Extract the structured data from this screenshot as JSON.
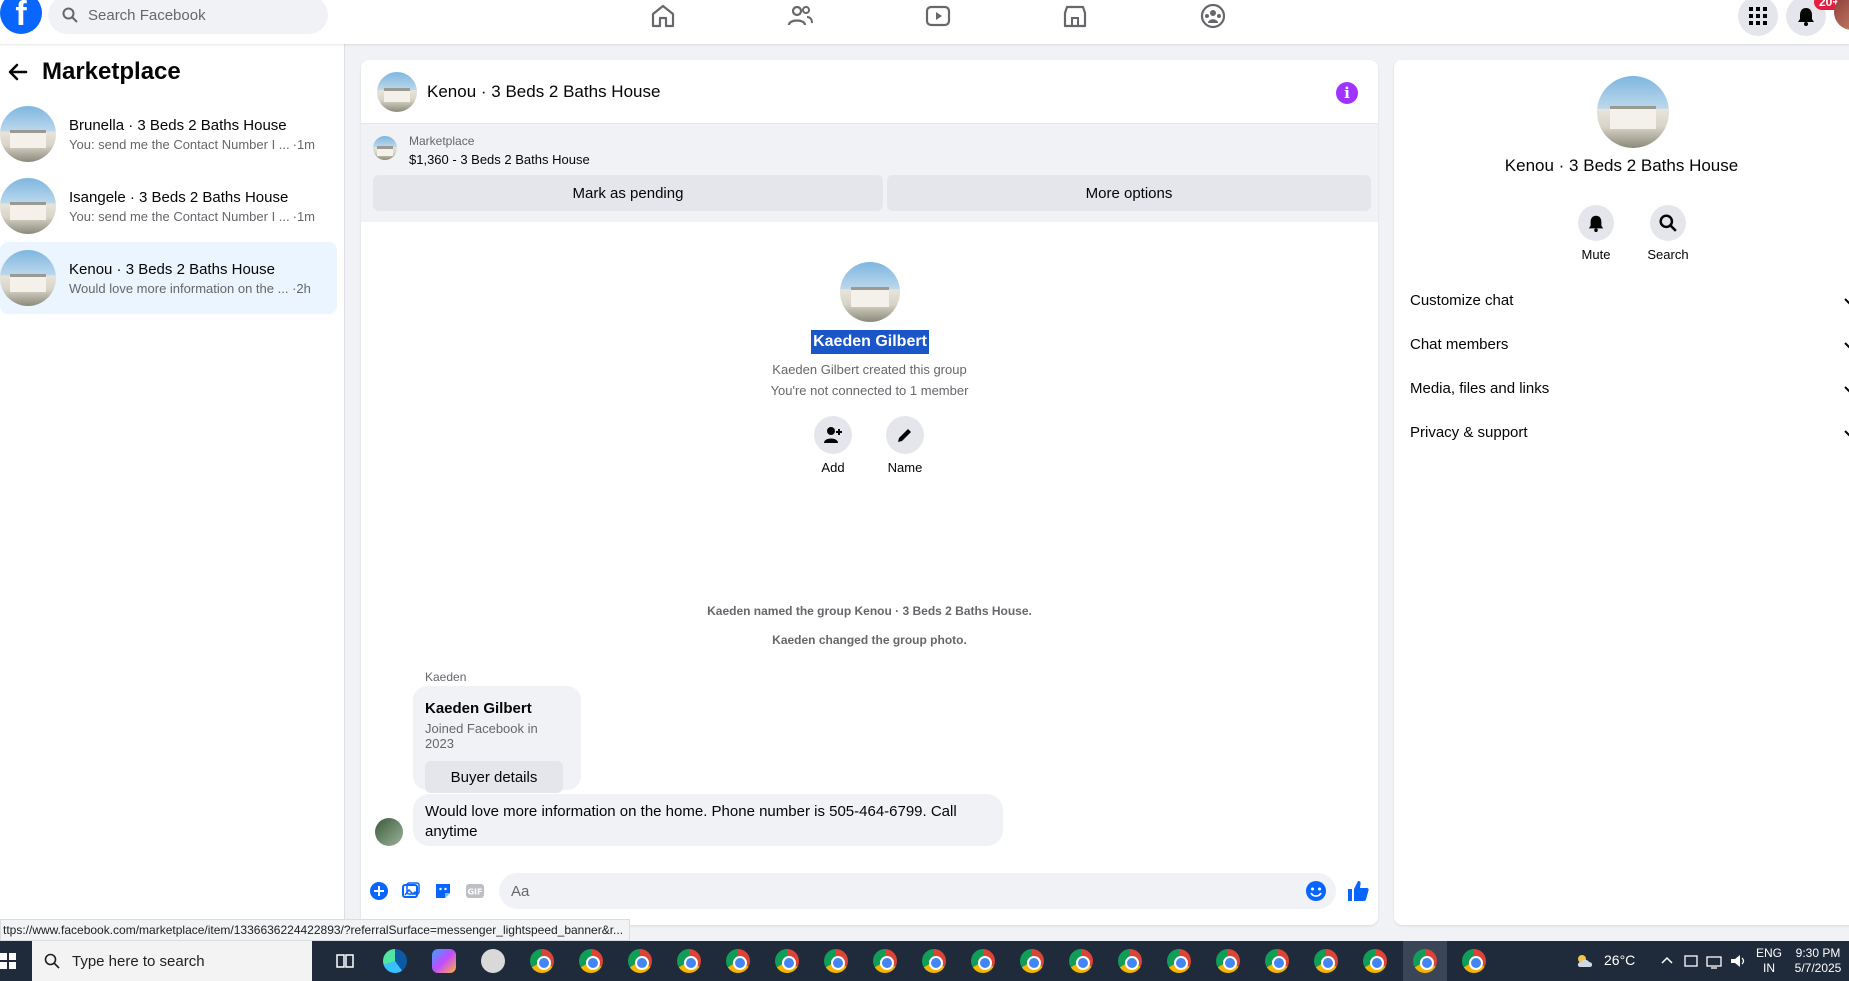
{
  "topbar": {
    "logo": "f",
    "search_placeholder": "Search Facebook",
    "notif_badge": "20+",
    "nav_icons": [
      "home-icon",
      "friends-icon",
      "watch-icon",
      "marketplace-icon",
      "groups-icon"
    ]
  },
  "sidebar": {
    "title": "Marketplace",
    "conversations": [
      {
        "title": "Brunella · 3 Beds 2 Baths House",
        "preview": "You: send me the Contact Number I ...",
        "time": "·1m"
      },
      {
        "title": "Isangele · 3 Beds 2 Baths House",
        "preview": "You: send me the Contact Number I ...",
        "time": "·1m"
      },
      {
        "title": "Kenou · 3 Beds 2 Baths House",
        "preview": "Would love more information on the ...",
        "time": "·2h"
      }
    ]
  },
  "chat": {
    "title": "Kenou · 3 Beds 2 Baths House",
    "marketplace_label": "Marketplace",
    "listing": "$1,360 - 3 Beds 2 Baths House",
    "mark_pending": "Mark as pending",
    "more_options": "More options",
    "member_name": "Kaeden Gilbert",
    "created_text": "Kaeden Gilbert created this group",
    "connected_text": "You're not connected to 1 member",
    "add_label": "Add",
    "name_label": "Name",
    "sys_named": "Kaeden named the group Kenou · 3 Beds 2 Baths House.",
    "sys_photo": "Kaeden changed the group photo.",
    "sender": "Kaeden",
    "card_name": "Kaeden Gilbert",
    "card_joined": "Joined Facebook in 2023",
    "card_button": "Buyer details",
    "message": "Would love more information on the home. Phone number is 505-464-6799. Call anytime",
    "composer_placeholder": "Aa"
  },
  "rpanel": {
    "name": "Kenou · 3 Beds 2 Baths House",
    "mute": "Mute",
    "search": "Search",
    "items": [
      "Customize chat",
      "Chat members",
      "Media, files and links",
      "Privacy & support"
    ]
  },
  "status_url": "ttps://www.facebook.com/marketplace/item/1336636224422893/?referralSurface=messenger_lightspeed_banner&r...",
  "taskbar": {
    "search_placeholder": "Type here to search",
    "temp": "26°C",
    "lang1": "ENG",
    "lang2": "IN",
    "time": "9:30 PM",
    "date": "5/7/2025"
  },
  "colors": {
    "brand": "#0866ff",
    "info": "#a033ff",
    "selection": "#1a56c8",
    "like": "#0866ff"
  }
}
